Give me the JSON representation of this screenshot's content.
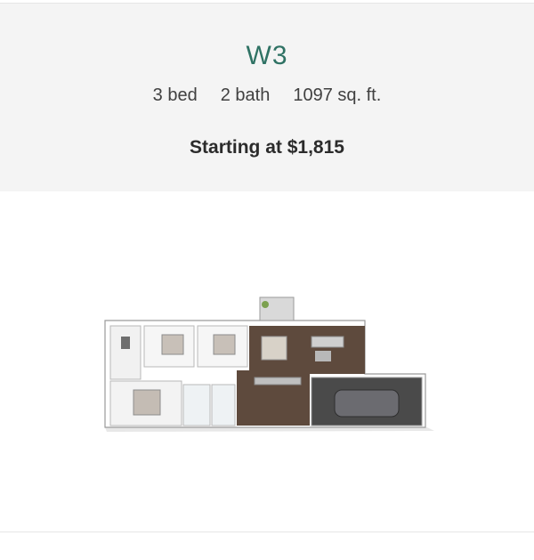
{
  "listing": {
    "plan_name": "W3",
    "beds": "3 bed",
    "baths": "2 bath",
    "area": "1097 sq. ft.",
    "price": "Starting at $1,815"
  },
  "floorplan": {
    "icon": "floorplan-3d-image"
  },
  "colors": {
    "accent": "#2f7264",
    "header_bg": "#f4f4f4"
  }
}
